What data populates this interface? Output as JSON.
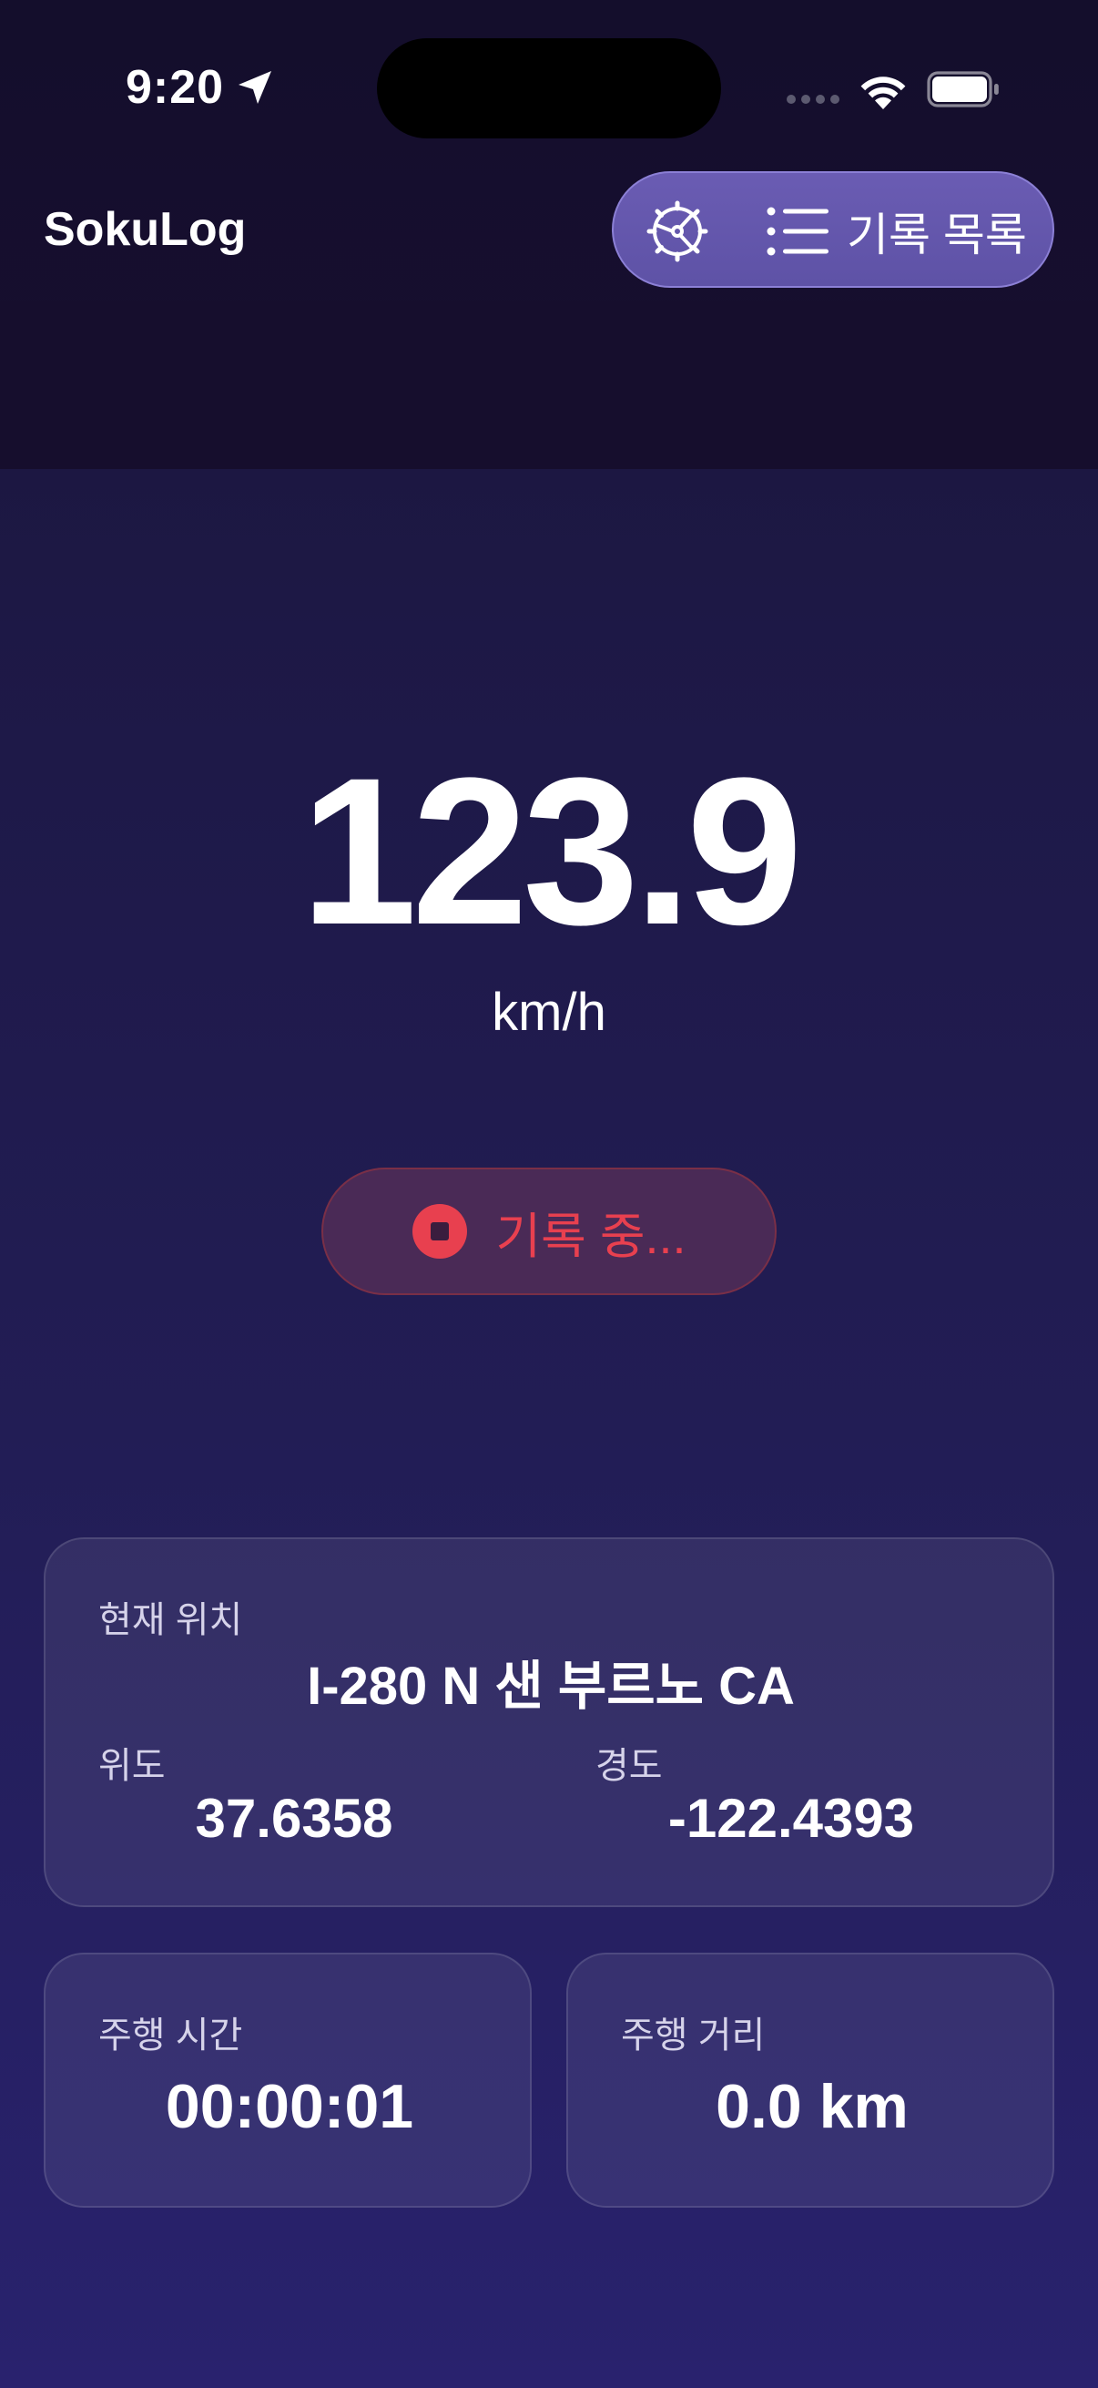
{
  "status_bar": {
    "time": "9:20"
  },
  "header": {
    "app_title": "SokuLog",
    "records_label": "기록 목록"
  },
  "speed": {
    "value": "123.9",
    "unit": "km/h"
  },
  "record_button": {
    "label": "기록 중..."
  },
  "location_card": {
    "title": "현재 위치",
    "address": "I-280 N 샌 부르노 CA",
    "latitude_label": "위도",
    "latitude_value": "37.6358",
    "longitude_label": "경도",
    "longitude_value": "-122.4393"
  },
  "time_card": {
    "label": "주행 시간",
    "value": "00:00:01"
  },
  "distance_card": {
    "label": "주행 거리",
    "value": "0.0 km"
  },
  "colors": {
    "recording_red": "#e8404f",
    "header_pill": "#6a5cb3",
    "background": "#221d55"
  },
  "icons": {
    "location": "navigation-arrow-icon",
    "wifi": "wifi-icon",
    "battery": "battery-icon",
    "settings": "steering-wheel-gear-icon",
    "records": "list-icon",
    "stop": "stop-icon"
  }
}
